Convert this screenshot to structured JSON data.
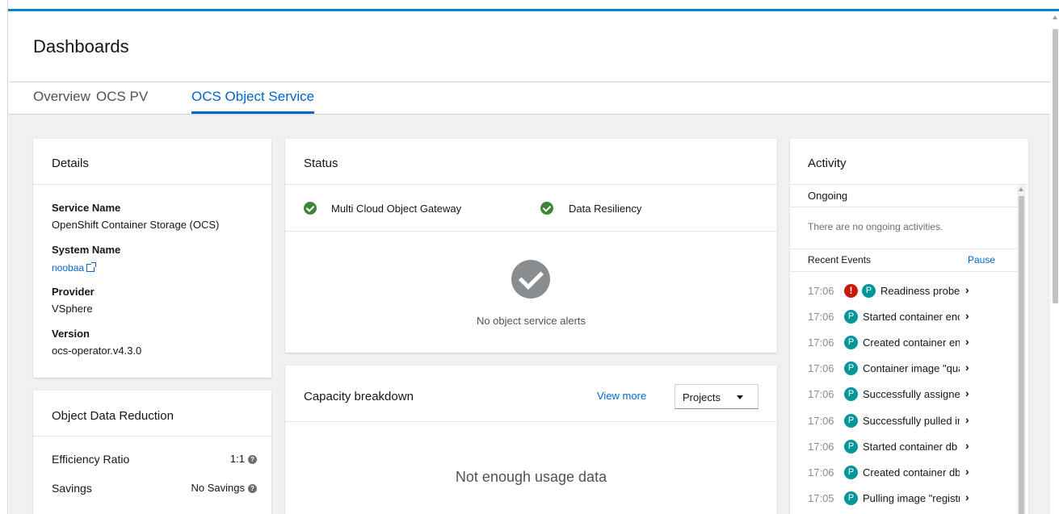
{
  "header": {
    "title": "Dashboards"
  },
  "tabs": [
    {
      "label": "Overview",
      "active": false
    },
    {
      "label": "OCS PV",
      "active": false
    },
    {
      "label": "OCS Object Service",
      "active": true
    }
  ],
  "details": {
    "title": "Details",
    "fields": [
      {
        "label": "Service Name",
        "value": "OpenShift Container Storage (OCS)"
      },
      {
        "label": "System Name",
        "value": "noobaa",
        "is_link": true
      },
      {
        "label": "Provider",
        "value": "VSphere"
      },
      {
        "label": "Version",
        "value": "ocs-operator.v4.3.0"
      }
    ]
  },
  "reduction": {
    "title": "Object Data Reduction",
    "rows": [
      {
        "label": "Efficiency Ratio",
        "value": "1:1"
      },
      {
        "label": "Savings",
        "value": "No Savings"
      }
    ]
  },
  "status": {
    "title": "Status",
    "items": [
      {
        "label": "Multi Cloud Object Gateway",
        "state": "ok"
      },
      {
        "label": "Data Resiliency",
        "state": "ok"
      }
    ],
    "alerts_empty": "No object service alerts"
  },
  "capacity": {
    "title": "Capacity breakdown",
    "view_more": "View more",
    "dropdown_value": "Projects",
    "empty": "Not enough usage data"
  },
  "activity": {
    "title": "Activity",
    "ongoing_label": "Ongoing",
    "ongoing_empty": "There are no ongoing activities.",
    "recent_label": "Recent Events",
    "pause_label": "Pause",
    "events": [
      {
        "time": "17:06",
        "error": true,
        "badge": "P",
        "text": "Readiness probe f..."
      },
      {
        "time": "17:06",
        "error": false,
        "badge": "P",
        "text": "Started container end..."
      },
      {
        "time": "17:06",
        "error": false,
        "badge": "P",
        "text": "Created container end..."
      },
      {
        "time": "17:06",
        "error": false,
        "badge": "P",
        "text": "Container image \"qua..."
      },
      {
        "time": "17:06",
        "error": false,
        "badge": "P",
        "text": "Successfully assigned ..."
      },
      {
        "time": "17:06",
        "error": false,
        "badge": "P",
        "text": "Successfully pulled im..."
      },
      {
        "time": "17:06",
        "error": false,
        "badge": "P",
        "text": "Started container db"
      },
      {
        "time": "17:06",
        "error": false,
        "badge": "P",
        "text": "Created container db"
      },
      {
        "time": "17:05",
        "error": false,
        "badge": "P",
        "text": "Pulling image \"registry..."
      }
    ]
  },
  "colors": {
    "accent": "#0066cc",
    "success": "#3e8635",
    "danger": "#c9190b",
    "pod_badge": "#009596"
  }
}
